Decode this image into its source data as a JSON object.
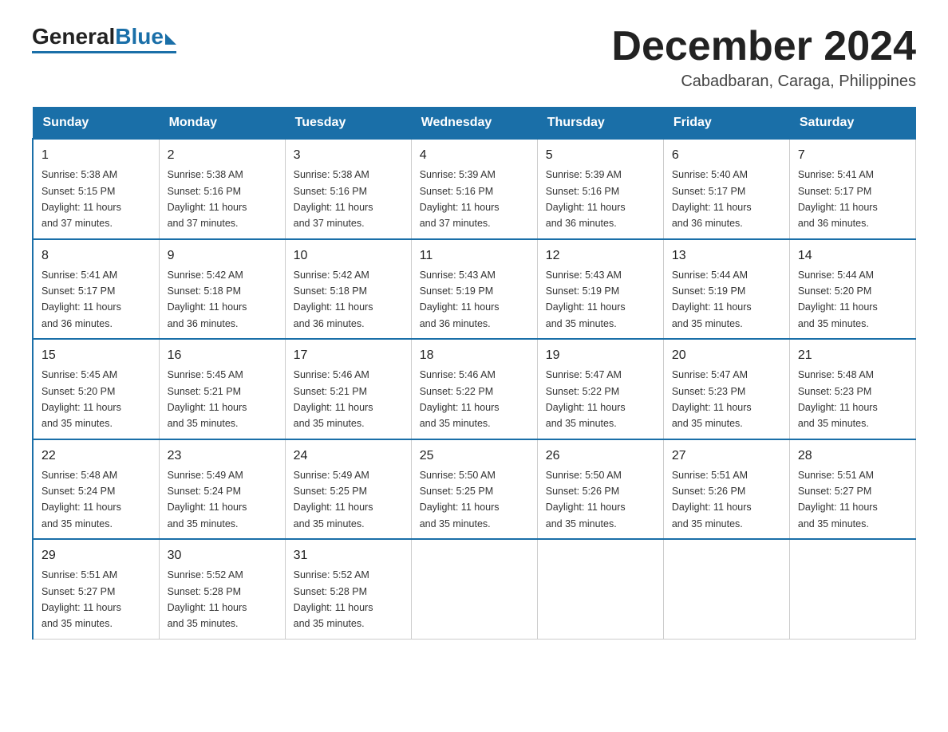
{
  "logo": {
    "general": "General",
    "blue": "Blue",
    "tagline": "Blue"
  },
  "header": {
    "month_year": "December 2024",
    "location": "Cabadbaran, Caraga, Philippines"
  },
  "days_of_week": [
    "Sunday",
    "Monday",
    "Tuesday",
    "Wednesday",
    "Thursday",
    "Friday",
    "Saturday"
  ],
  "weeks": [
    [
      {
        "day": "1",
        "sunrise": "5:38 AM",
        "sunset": "5:15 PM",
        "daylight": "11 hours and 37 minutes."
      },
      {
        "day": "2",
        "sunrise": "5:38 AM",
        "sunset": "5:16 PM",
        "daylight": "11 hours and 37 minutes."
      },
      {
        "day": "3",
        "sunrise": "5:38 AM",
        "sunset": "5:16 PM",
        "daylight": "11 hours and 37 minutes."
      },
      {
        "day": "4",
        "sunrise": "5:39 AM",
        "sunset": "5:16 PM",
        "daylight": "11 hours and 37 minutes."
      },
      {
        "day": "5",
        "sunrise": "5:39 AM",
        "sunset": "5:16 PM",
        "daylight": "11 hours and 36 minutes."
      },
      {
        "day": "6",
        "sunrise": "5:40 AM",
        "sunset": "5:17 PM",
        "daylight": "11 hours and 36 minutes."
      },
      {
        "day": "7",
        "sunrise": "5:41 AM",
        "sunset": "5:17 PM",
        "daylight": "11 hours and 36 minutes."
      }
    ],
    [
      {
        "day": "8",
        "sunrise": "5:41 AM",
        "sunset": "5:17 PM",
        "daylight": "11 hours and 36 minutes."
      },
      {
        "day": "9",
        "sunrise": "5:42 AM",
        "sunset": "5:18 PM",
        "daylight": "11 hours and 36 minutes."
      },
      {
        "day": "10",
        "sunrise": "5:42 AM",
        "sunset": "5:18 PM",
        "daylight": "11 hours and 36 minutes."
      },
      {
        "day": "11",
        "sunrise": "5:43 AM",
        "sunset": "5:19 PM",
        "daylight": "11 hours and 36 minutes."
      },
      {
        "day": "12",
        "sunrise": "5:43 AM",
        "sunset": "5:19 PM",
        "daylight": "11 hours and 35 minutes."
      },
      {
        "day": "13",
        "sunrise": "5:44 AM",
        "sunset": "5:19 PM",
        "daylight": "11 hours and 35 minutes."
      },
      {
        "day": "14",
        "sunrise": "5:44 AM",
        "sunset": "5:20 PM",
        "daylight": "11 hours and 35 minutes."
      }
    ],
    [
      {
        "day": "15",
        "sunrise": "5:45 AM",
        "sunset": "5:20 PM",
        "daylight": "11 hours and 35 minutes."
      },
      {
        "day": "16",
        "sunrise": "5:45 AM",
        "sunset": "5:21 PM",
        "daylight": "11 hours and 35 minutes."
      },
      {
        "day": "17",
        "sunrise": "5:46 AM",
        "sunset": "5:21 PM",
        "daylight": "11 hours and 35 minutes."
      },
      {
        "day": "18",
        "sunrise": "5:46 AM",
        "sunset": "5:22 PM",
        "daylight": "11 hours and 35 minutes."
      },
      {
        "day": "19",
        "sunrise": "5:47 AM",
        "sunset": "5:22 PM",
        "daylight": "11 hours and 35 minutes."
      },
      {
        "day": "20",
        "sunrise": "5:47 AM",
        "sunset": "5:23 PM",
        "daylight": "11 hours and 35 minutes."
      },
      {
        "day": "21",
        "sunrise": "5:48 AM",
        "sunset": "5:23 PM",
        "daylight": "11 hours and 35 minutes."
      }
    ],
    [
      {
        "day": "22",
        "sunrise": "5:48 AM",
        "sunset": "5:24 PM",
        "daylight": "11 hours and 35 minutes."
      },
      {
        "day": "23",
        "sunrise": "5:49 AM",
        "sunset": "5:24 PM",
        "daylight": "11 hours and 35 minutes."
      },
      {
        "day": "24",
        "sunrise": "5:49 AM",
        "sunset": "5:25 PM",
        "daylight": "11 hours and 35 minutes."
      },
      {
        "day": "25",
        "sunrise": "5:50 AM",
        "sunset": "5:25 PM",
        "daylight": "11 hours and 35 minutes."
      },
      {
        "day": "26",
        "sunrise": "5:50 AM",
        "sunset": "5:26 PM",
        "daylight": "11 hours and 35 minutes."
      },
      {
        "day": "27",
        "sunrise": "5:51 AM",
        "sunset": "5:26 PM",
        "daylight": "11 hours and 35 minutes."
      },
      {
        "day": "28",
        "sunrise": "5:51 AM",
        "sunset": "5:27 PM",
        "daylight": "11 hours and 35 minutes."
      }
    ],
    [
      {
        "day": "29",
        "sunrise": "5:51 AM",
        "sunset": "5:27 PM",
        "daylight": "11 hours and 35 minutes."
      },
      {
        "day": "30",
        "sunrise": "5:52 AM",
        "sunset": "5:28 PM",
        "daylight": "11 hours and 35 minutes."
      },
      {
        "day": "31",
        "sunrise": "5:52 AM",
        "sunset": "5:28 PM",
        "daylight": "11 hours and 35 minutes."
      },
      null,
      null,
      null,
      null
    ]
  ],
  "labels": {
    "sunrise": "Sunrise: ",
    "sunset": "Sunset: ",
    "daylight": "Daylight: "
  }
}
